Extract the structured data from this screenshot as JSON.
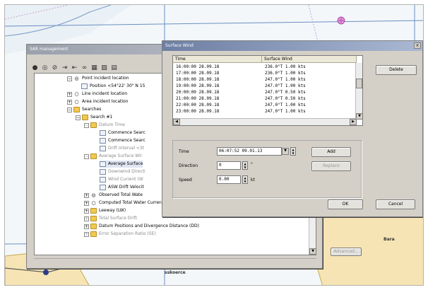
{
  "map": {
    "label_1": "Bara",
    "label_2": "sskoerce"
  },
  "sar_window": {
    "title": "SAR management",
    "toolbar_icons": [
      "circle-filled-icon",
      "target-icon",
      "cancel-icon",
      "import-icon",
      "export-icon",
      "binoculars-icon",
      "table-icon",
      "chart-icon",
      "calendar-icon"
    ],
    "tree": {
      "point_incident": "Point incident location",
      "position": "Position <54°22' 30\" N 15",
      "line_incident": "Line incident location",
      "area_incident": "Area incident location",
      "searches": "Searches",
      "search1": "Search #1",
      "datum_time": "Datum Time",
      "commence1": "Commence Searc",
      "commence2": "Commence Searc",
      "drift_interval": "Drift Interval <3t",
      "avg_surface_wind": "Average Surface Wir",
      "avg_surface_sel": "Average Surface",
      "downwind": "Downwind Directi",
      "wind_current": "Wind Current (W",
      "asw_drift": "ASW Drift Velocit",
      "observed": "Observed Total Wate",
      "computed": "Computed Total Water Current",
      "leeway": "Leeway (LW)",
      "total_surface_drift": "Total Surface Drift",
      "datum_positions": "Datum Positions and Divergence Distance (DD)",
      "error_ratio": "Error Separation Ratio (SE)"
    },
    "advanced_label": "Advanced..."
  },
  "surface_wind": {
    "title": "Surface Wind",
    "columns": [
      "Time",
      "Surface Wind"
    ],
    "rows": [
      [
        "16:00:00  28.09.18",
        "236.0°T 1.00 kts"
      ],
      [
        "17:00:00  28.09.18",
        "236.0°T 1.00 kts"
      ],
      [
        "18:00:00  28.09.18",
        "247.0°T 1.00 kts"
      ],
      [
        "19:00:00  28.09.18",
        "247.0°T 1.00 kts"
      ],
      [
        "20:00:00  28.09.18",
        "247.0°T 0.50 kts"
      ],
      [
        "21:00:00  28.09.18",
        "247.0°T 0.50 kts"
      ],
      [
        "22:00:00  28.09.18",
        "247.0°T 1.00 kts"
      ],
      [
        "23:00:00  28.09.18",
        "247.0°T 1.00 kts"
      ]
    ],
    "delete_label": "Delete",
    "time_label": "Time",
    "time_value": "06:07:52  09.01.13",
    "direction_label": "Direction",
    "direction_value": "0",
    "direction_unit": "°",
    "speed_label": "Speed",
    "speed_value": "0.00",
    "speed_unit": "kt",
    "add_label": "Add",
    "replace_label": "Replace",
    "ok_label": "OK",
    "cancel_label": "Cancel"
  }
}
